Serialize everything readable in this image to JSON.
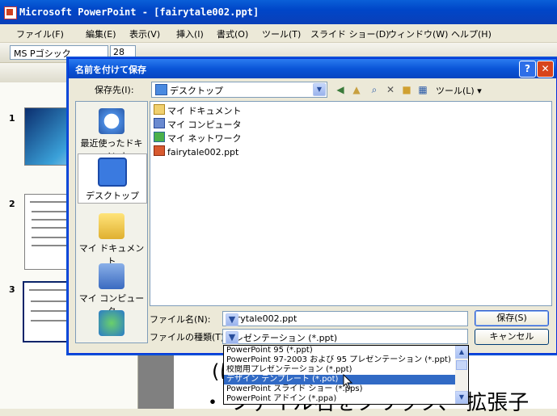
{
  "app": {
    "title": "Microsoft PowerPoint - [fairytale002.ppt]"
  },
  "menu": [
    "ファイル(F)",
    "編集(E)",
    "表示(V)",
    "挿入(I)",
    "書式(O)",
    "ツール(T)",
    "スライド ショー(D)",
    "ウィンドウ(W)",
    "ヘルプ(H)"
  ],
  "toolbar": {
    "font": "MS Pゴシック",
    "size": "28"
  },
  "slides": [
    {
      "num": "1"
    },
    {
      "num": "2"
    },
    {
      "num": "3"
    }
  ],
  "slide_text": {
    "line1": "(は",
    "line2": "・ ファイル名をクリック、 拡張子"
  },
  "dialog": {
    "title": "名前を付けて保存",
    "help": "?",
    "close": "✕",
    "save_in_label": "保存先(I):",
    "save_in_value": "デスクトップ",
    "tools_label": "ツール(L) ▾",
    "places": [
      "最近使ったドキュメント",
      "デスクトップ",
      "マイ ドキュメント",
      "マイ コンピュータ"
    ],
    "files": [
      "マイ ドキュメント",
      "マイ コンピュータ",
      "マイ ネットワーク",
      "fairytale002.ppt"
    ],
    "filename_label": "ファイル名(N):",
    "filename_value": "fairytale002.ppt",
    "filetype_label": "ファイルの種類(T):",
    "filetype_value": "プレゼンテーション (*.ppt)",
    "save_button": "保存(S)",
    "cancel_button": "キャンセル"
  },
  "dropdown": {
    "options": [
      "PowerPoint 95 (*.ppt)",
      "PowerPoint 97-2003 および 95 プレゼンテーション (*.ppt)",
      "校閲用プレゼンテーション (*.ppt)",
      "デザイン テンプレート (*.pot)",
      "PowerPoint スライド ショー (*.pps)",
      "PowerPoint アドイン (*.ppa)"
    ],
    "selected_index": 3
  }
}
